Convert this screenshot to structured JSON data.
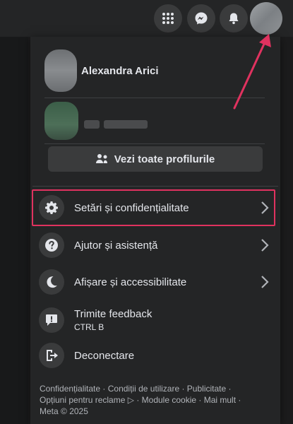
{
  "header": {
    "icons": [
      "menu-grid-icon",
      "messenger-icon",
      "notifications-bell-icon",
      "account-avatar"
    ]
  },
  "account_menu": {
    "profile_name": "Alexandra Arici",
    "see_all_profiles_label": "Vezi toate profilurile",
    "items": [
      {
        "label": "Setări și confidențialitate",
        "icon": "gear-icon",
        "has_chevron": true,
        "highlighted": true
      },
      {
        "label": "Ajutor și asistență",
        "icon": "help-icon",
        "has_chevron": true
      },
      {
        "label": "Afișare și accessibilitate",
        "icon": "moon-icon",
        "has_chevron": true
      },
      {
        "label": "Trimite feedback",
        "sublabel": "CTRL B",
        "icon": "feedback-icon",
        "has_chevron": false
      },
      {
        "label": "Deconectare",
        "icon": "logout-icon",
        "has_chevron": false
      }
    ],
    "footer": {
      "links": [
        "Confidențialitate",
        "Condiții de utilizare",
        "Publicitate",
        "Opțiuni pentru reclame",
        "Module cookie",
        "Mai mult"
      ],
      "copyright": "Meta © 2025"
    }
  },
  "colors": {
    "panel_bg": "#242526",
    "button_bg": "#3a3b3c",
    "text": "#e4e6eb",
    "secondary_text": "#b0b3b8",
    "highlight": "#e0325f"
  }
}
